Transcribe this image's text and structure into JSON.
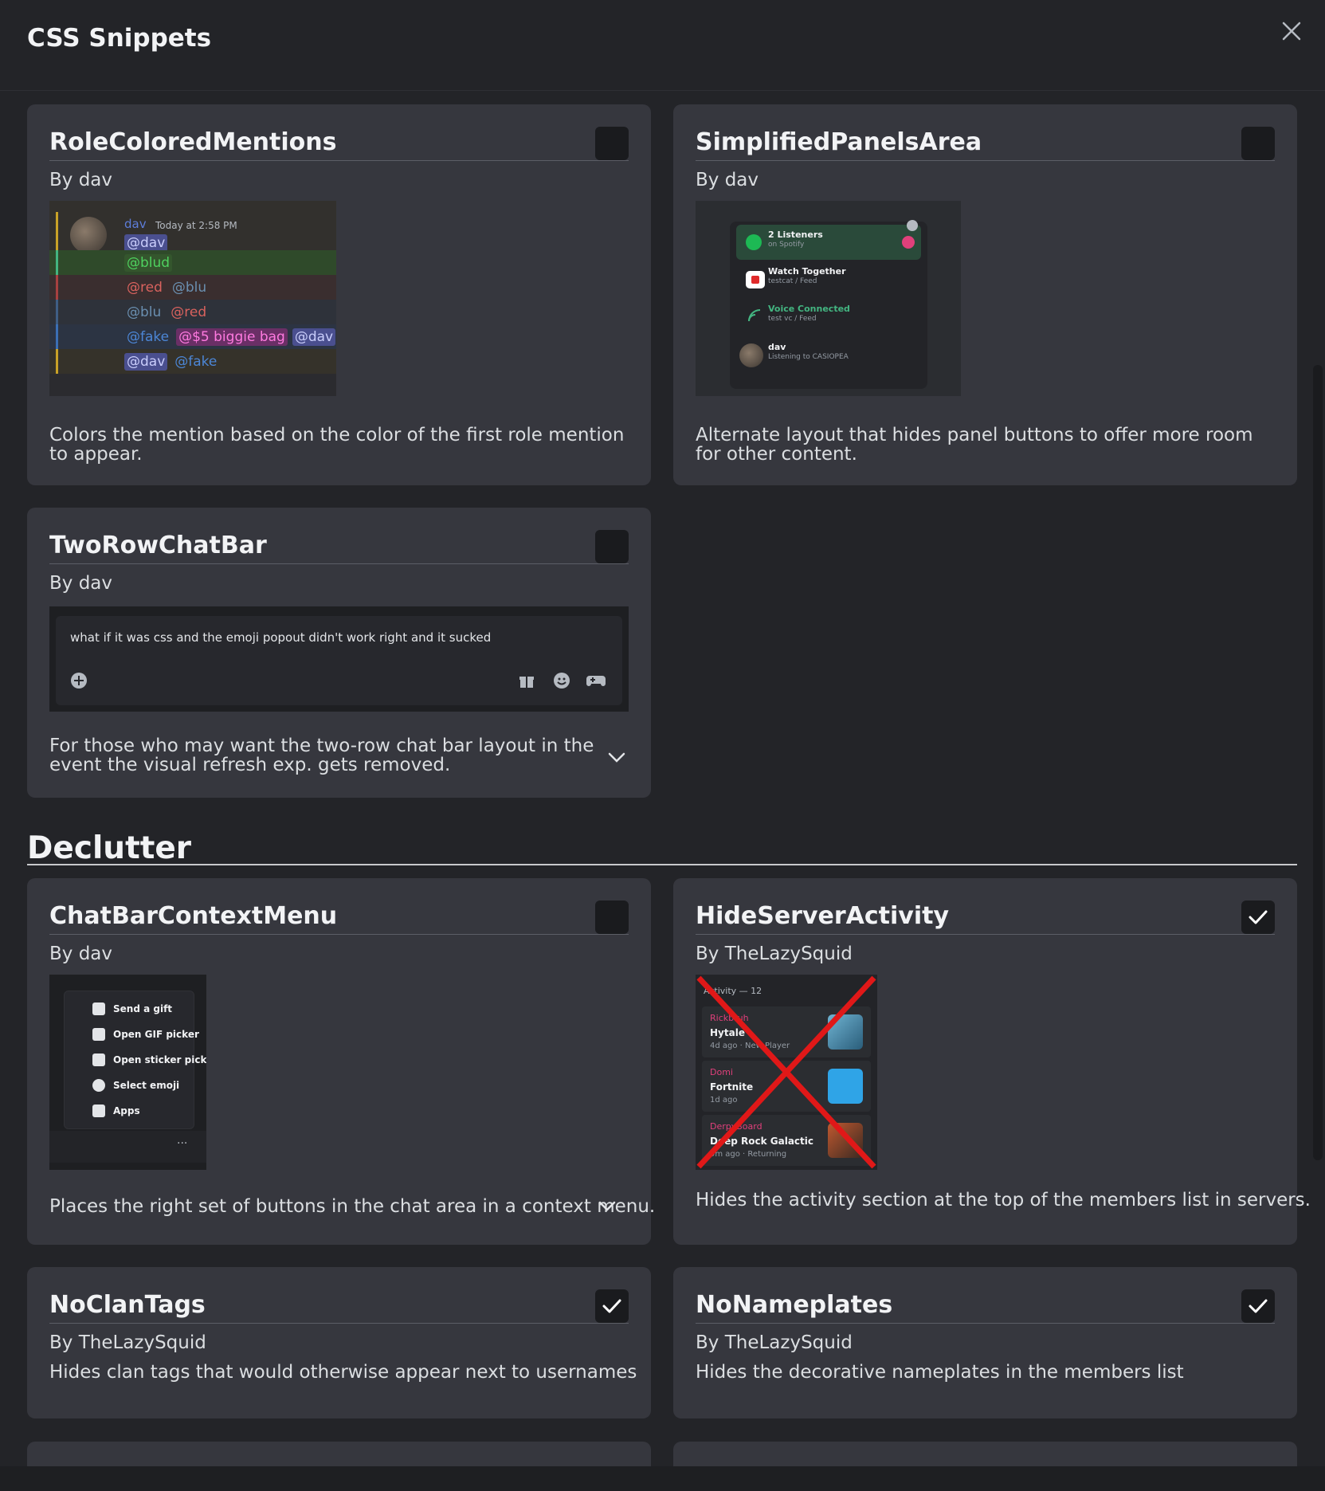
{
  "modal": {
    "title": "CSS Snippets"
  },
  "cards": {
    "role_colored": {
      "title": "RoleColoredMentions",
      "author": "By dav",
      "description": "Colors the mention based on the color of the first role mention to appear.",
      "checked": false,
      "preview": {
        "username": "dav",
        "timestamp": "Today at 2:58 PM",
        "mentions": [
          "@dav",
          "@blud",
          "@red",
          "@blu",
          "@blu",
          "@red",
          "@fake",
          "@$5 biggie bag",
          "@dav",
          "@dav",
          "@fake"
        ]
      }
    },
    "simplified_panels": {
      "title": "SimplifiedPanelsArea",
      "author": "By dav",
      "description": "Alternate layout that hides panel buttons to offer more room for other content.",
      "checked": false,
      "preview": {
        "row1_title": "2 Listeners",
        "row1_sub": "on Spotify",
        "row2_title": "Watch Together",
        "row2_sub": "testcat / Feed",
        "row3_title": "Voice Connected",
        "row3_sub": "test vc / Feed",
        "row4_title": "dav",
        "row4_sub": "Listening to CASIOPEA"
      }
    },
    "two_row_chat": {
      "title": "TwoRowChatBar",
      "author": "By dav",
      "description": "For those who may want the two-row chat bar layout in the event the visual refresh exp. gets removed.",
      "checked": false,
      "preview": {
        "message": "what if it was css and the emoji popout didn't work right and it sucked"
      }
    },
    "chatbar_context": {
      "title": "ChatBarContextMenu",
      "author": "By dav",
      "description": "Places the right set of buttons in the chat area in a context menu.",
      "checked": false,
      "preview": {
        "items": [
          "Send a gift",
          "Open GIF picker",
          "Open sticker picker",
          "Select emoji",
          "Apps"
        ],
        "more": "···"
      }
    },
    "hide_server_activity": {
      "title": "HideServerActivity",
      "author": "By TheLazySquid",
      "description": "Hides the activity section at the top of the members list in servers.",
      "checked": true,
      "preview": {
        "header": "Activity — 12",
        "entries": [
          {
            "user": "Rickbruh",
            "game": "Hytale",
            "meta": "4d ago · New Player"
          },
          {
            "user": "Domi",
            "game": "Fortnite",
            "meta": "1d ago"
          },
          {
            "user": "DerpyBoard",
            "game": "Deep Rock Galactic",
            "meta": "9m ago · Returning"
          }
        ]
      }
    },
    "no_clan_tags": {
      "title": "NoClanTags",
      "author": "By TheLazySquid",
      "description": "Hides clan tags that would otherwise appear next to usernames",
      "checked": true
    },
    "no_nameplates": {
      "title": "NoNameplates",
      "author": "By TheLazySquid",
      "description": "Hides the decorative nameplates in the members list",
      "checked": true
    }
  },
  "sections": {
    "declutter": "Declutter"
  },
  "colors": {
    "card_bg": "#36373e",
    "page_bg": "#232428",
    "checkbox_bg": "#1a1b1e",
    "mention_blue": "#5865f2"
  }
}
